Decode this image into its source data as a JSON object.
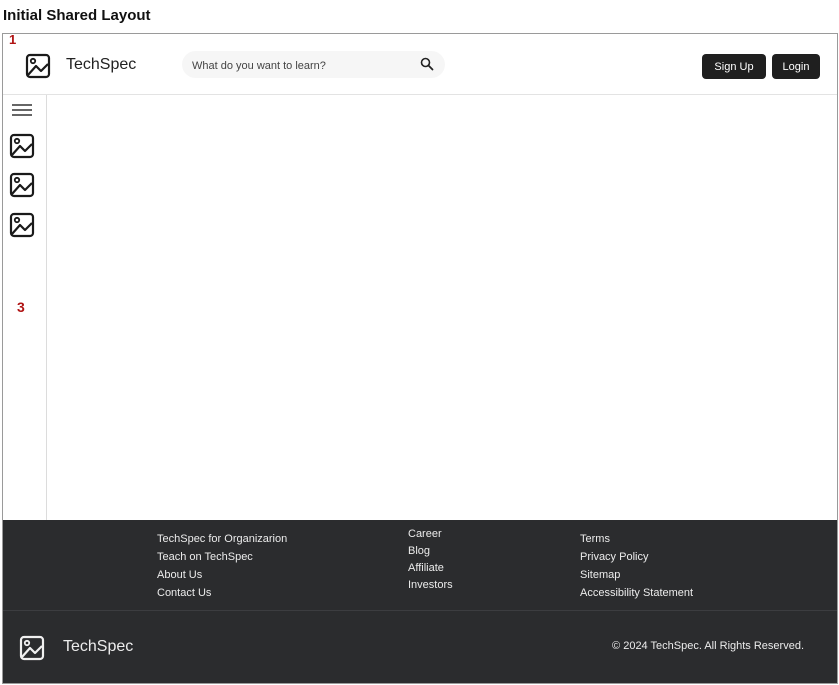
{
  "page_title": "Initial Shared Layout",
  "annotations": {
    "header_marker": "1",
    "sidebar_marker": "3"
  },
  "header": {
    "logo_icon": "image-placeholder-icon",
    "brand": "TechSpec",
    "search": {
      "placeholder": "What do you want to learn?",
      "value": "",
      "icon": "search-icon"
    },
    "signup_label": "Sign Up",
    "login_label": "Login"
  },
  "sidebar": {
    "menu_icon": "hamburger-menu-icon",
    "items": [
      {
        "icon": "image-placeholder-icon"
      },
      {
        "icon": "image-placeholder-icon"
      },
      {
        "icon": "image-placeholder-icon"
      }
    ]
  },
  "footer": {
    "columns": [
      [
        "TechSpec for Organizarion",
        "Teach on TechSpec",
        "About Us",
        "Contact Us"
      ],
      [
        "Career",
        "Blog",
        "Affiliate",
        "Investors"
      ],
      [
        "Terms",
        "Privacy Policy",
        "Sitemap",
        "Accessibility Statement"
      ]
    ],
    "brand": "TechSpec",
    "copyright": "© 2024 TechSpec. All Rights Reserved."
  },
  "colors": {
    "dark": "#2b2c2e",
    "button": "#1f1f1f",
    "annotation": "#b01313"
  }
}
